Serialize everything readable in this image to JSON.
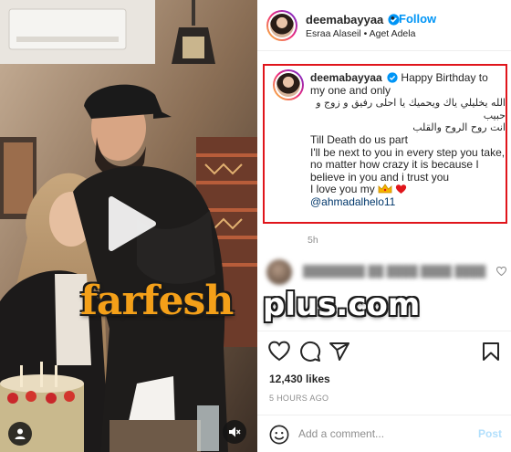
{
  "post": {
    "author": "deemabayyaa",
    "follow_label": "Follow",
    "separator": "•",
    "tagged_people": "Esraa Alaseil • Aget Adela",
    "caption": {
      "line1": "Happy Birthday to my one and only",
      "line2": "الله يخليلي ياك ويحميك يا احلى رفيق و زوج و حبيب",
      "line3": "انت روح الروح والقلب",
      "line4": "Till Death do us part",
      "line5": "I'll be next to you in every step you take, no matter how crazy it is because I believe in you and i trust you",
      "line6": "I love you my",
      "mention": "@ahmadalhelo11"
    },
    "time_ago": "5h",
    "likes": "12,430 likes",
    "posted_ago": "5 HOURS AGO"
  },
  "comment_input": {
    "placeholder": "Add a comment...",
    "post_label": "Post"
  },
  "watermark": {
    "part1": "farfesh",
    "part2": "plus.com"
  },
  "icons": [
    "play-icon",
    "user-tag-icon",
    "muted-speaker-icon",
    "verified-badge-icon",
    "heart-icon",
    "comment-icon",
    "share-icon",
    "bookmark-icon",
    "emoji-icon",
    "crown-emoji-icon",
    "red-heart-emoji-icon"
  ],
  "colors": {
    "accent_link": "#0095f6",
    "mention": "#00376b",
    "highlight_border": "#e0151b",
    "watermark_orange": "#f4a019"
  }
}
